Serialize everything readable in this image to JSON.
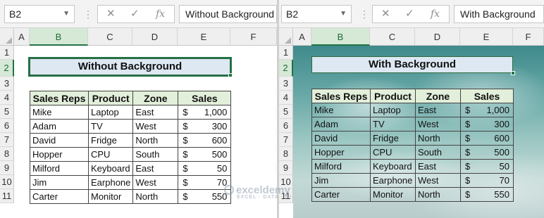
{
  "left": {
    "name_box": "B2",
    "formula": "Without Background",
    "columns": [
      "A",
      "B",
      "C",
      "D",
      "E",
      "F"
    ],
    "rows": [
      "1",
      "2",
      "3",
      "4",
      "5",
      "6",
      "7",
      "8",
      "9",
      "10",
      "11"
    ],
    "title": "Without Background",
    "headers": [
      "Sales Reps",
      "Product",
      "Zone",
      "Sales"
    ],
    "records": [
      [
        "Mike",
        "Laptop",
        "East",
        "$",
        "1,000"
      ],
      [
        "Adam",
        "TV",
        "West",
        "$",
        "300"
      ],
      [
        "David",
        "Fridge",
        "North",
        "$",
        "600"
      ],
      [
        "Hopper",
        "CPU",
        "South",
        "$",
        "500"
      ],
      [
        "Milford",
        "Keyboard",
        "East",
        "$",
        "50"
      ],
      [
        "Jim",
        "Earphone",
        "West",
        "$",
        "70"
      ],
      [
        "Carter",
        "Monitor",
        "North",
        "$",
        "550"
      ]
    ]
  },
  "right": {
    "name_box": "B2",
    "formula": "With Background",
    "columns": [
      "A",
      "B",
      "C",
      "D",
      "E",
      "F"
    ],
    "rows": [
      "1",
      "2",
      "3",
      "4",
      "5",
      "6",
      "7",
      "8",
      "9",
      "10",
      "11"
    ],
    "title": "With Background",
    "headers": [
      "Sales Reps",
      "Product",
      "Zone",
      "Sales"
    ],
    "records": [
      [
        "Mike",
        "Laptop",
        "East",
        "$",
        "1,000"
      ],
      [
        "Adam",
        "TV",
        "West",
        "$",
        "300"
      ],
      [
        "David",
        "Fridge",
        "North",
        "$",
        "600"
      ],
      [
        "Hopper",
        "CPU",
        "South",
        "$",
        "500"
      ],
      [
        "Milford",
        "Keyboard",
        "East",
        "$",
        "50"
      ],
      [
        "Jim",
        "Earphone",
        "West",
        "$",
        "70"
      ],
      [
        "Carter",
        "Monitor",
        "North",
        "$",
        "550"
      ]
    ]
  },
  "formula_buttons": {
    "cancel": "✕",
    "enter": "✓",
    "fx": "fx"
  },
  "watermark": {
    "name": "exceldemy",
    "tagline": "EXCEL · DATA · BI"
  },
  "colors": {
    "excel_green": "#217346",
    "header_fill": "#e2efda",
    "title_fill": "#dde8f3"
  }
}
